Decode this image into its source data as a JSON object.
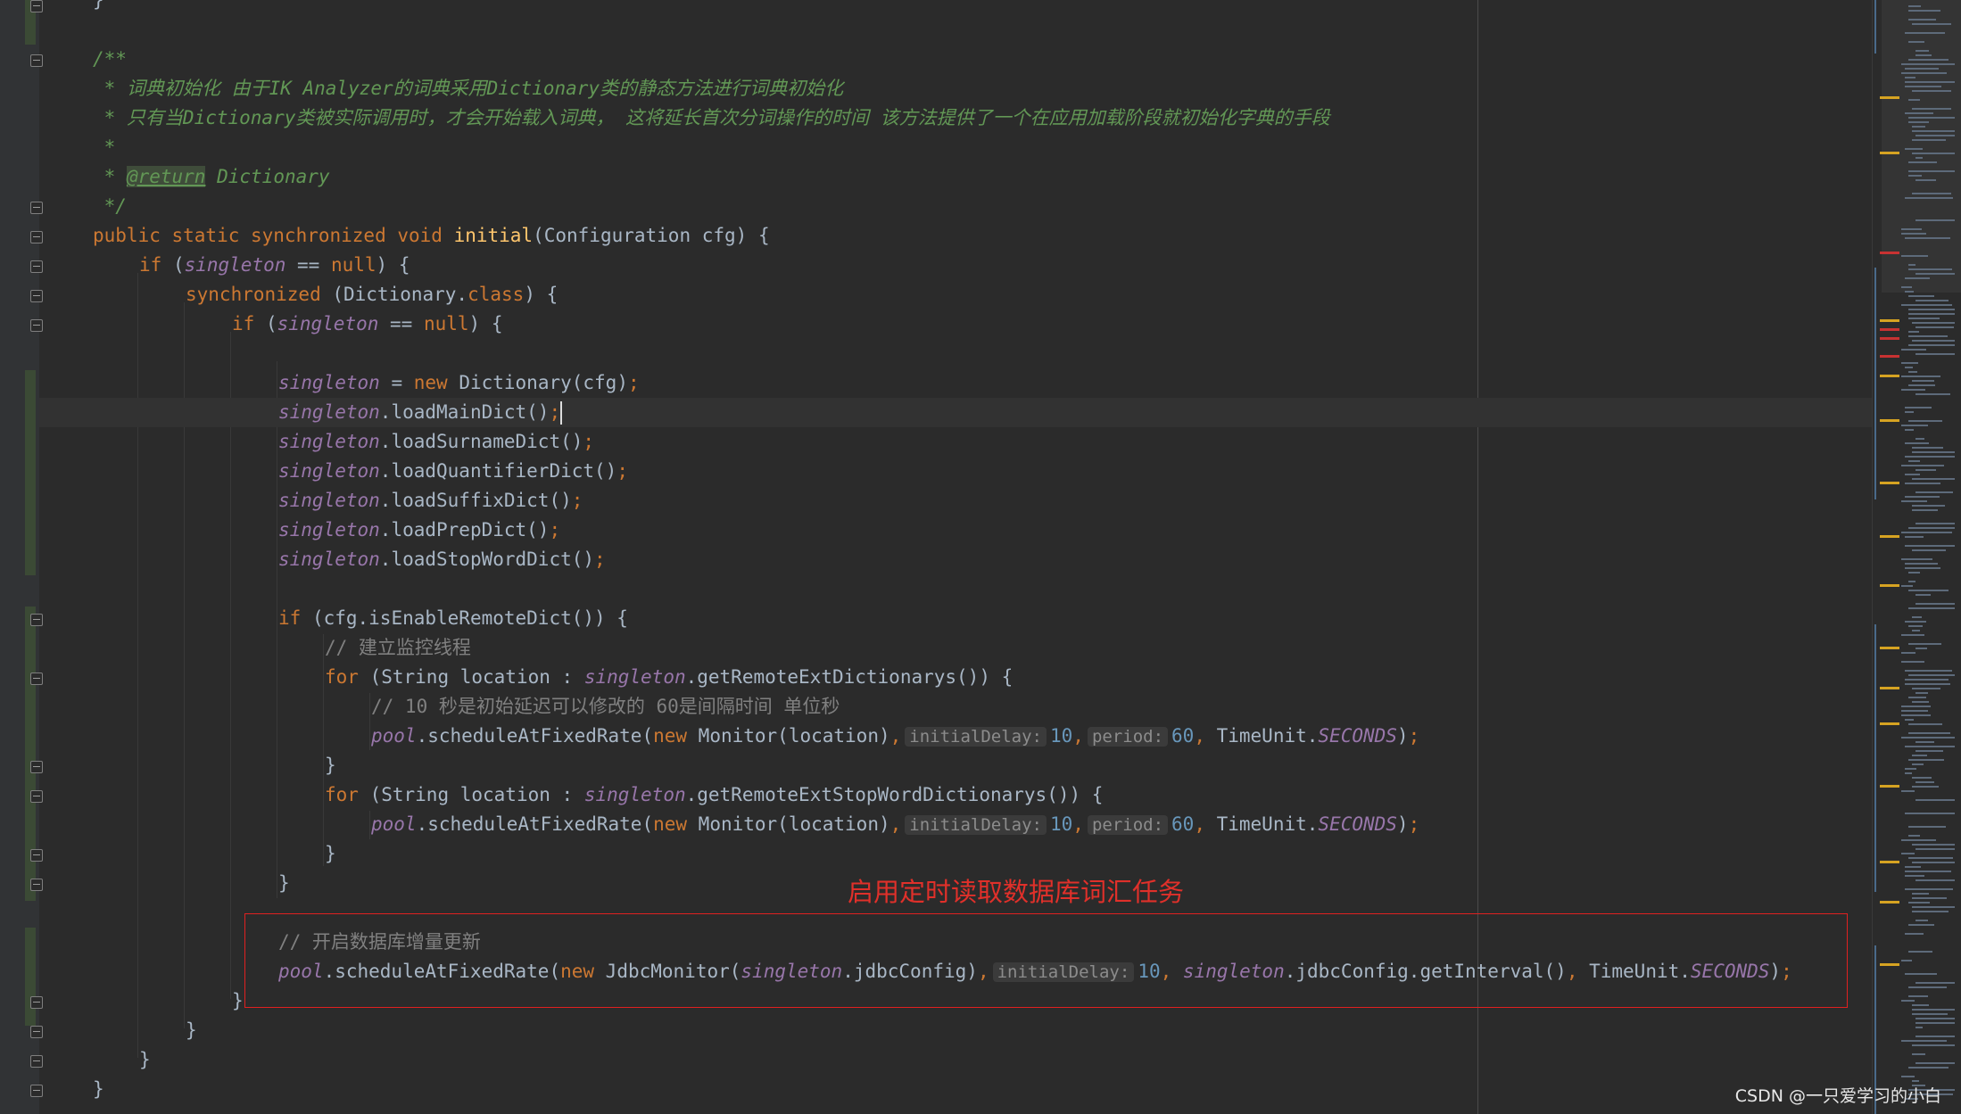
{
  "code": {
    "l0": "}",
    "doc_open": "/**",
    "doc_line1": " * 词典初始化 由于IK Analyzer的词典采用Dictionary类的静态方法进行词典初始化",
    "doc_line2": " * 只有当Dictionary类被实际调用时，才会开始载入词典， 这将延长首次分词操作的时间 该方法提供了一个在应用加载阶段就初始化字典的手段",
    "doc_star": " *",
    "doc_return_tag": "@return",
    "doc_return_type": " Dictionary",
    "doc_close": " */",
    "kw_public_static_sync_void": "public static synchronized void ",
    "method_initial": "initial",
    "initial_params": "(Configuration cfg) {",
    "kw_if": "if",
    "singleton": "singleton",
    "eq_null": " == ",
    "kw_null": "null",
    "close_paren_brace": ") {",
    "kw_synchronized": "synchronized",
    "dict_class_open": " (Dictionary.",
    "kw_class": "class",
    "kw_new": "new",
    "new_dict": " Dictionary(cfg)",
    "semicolon": ";",
    "assign": " = ",
    "loadMainDict": ".loadMainDict()",
    "loadSurnameDict": ".loadSurnameDict()",
    "loadQuantifierDict": ".loadQuantifierDict()",
    "loadSuffixDict": ".loadSuffixDict()",
    "loadPrepDict": ".loadPrepDict()",
    "loadStopWordDict": ".loadStopWordDict()",
    "if_remote": " (cfg.isEnableRemoteDict()) {",
    "comment_monitor": "// 建立监控线程",
    "kw_for": "for",
    "for_open": " (String location : ",
    "getRemoteExt": ".getRemoteExtDictionarys()) {",
    "comment_delay": "// 10 秒是初始延迟可以修改的 60是间隔时间 单位秒",
    "pool": "pool",
    "schedule_open": ".scheduleAtFixedRate(",
    "monitor_call": " Monitor(location)",
    "comma": ",",
    "hint_initialDelay": "initialDelay:",
    "val_10": "10",
    "hint_period": "period:",
    "val_60": "60",
    "timeunit": " TimeUnit.",
    "seconds": "SECONDS",
    "close_paren": ")",
    "close_brace": "}",
    "getRemoteExtStop": ".getRemoteExtStopWordDictionarys()) {",
    "comment_db": "// 开启数据库增量更新",
    "jdbc_monitor": " JdbcMonitor(",
    "jdbc_config": ".jdbcConfig",
    "get_interval": ".getInterval()"
  },
  "annotation": {
    "label": "启用定时读取数据库词汇任务",
    "color": "#e0302a"
  },
  "watermark": "CSDN @一只爱学习的小白",
  "theme": {
    "background": "#2b2b2b",
    "keyword": "#cc7832",
    "method": "#ffc66d",
    "static_field": "#9876aa",
    "number": "#6897bb",
    "comment": "#808080",
    "doc_comment": "#629755"
  }
}
